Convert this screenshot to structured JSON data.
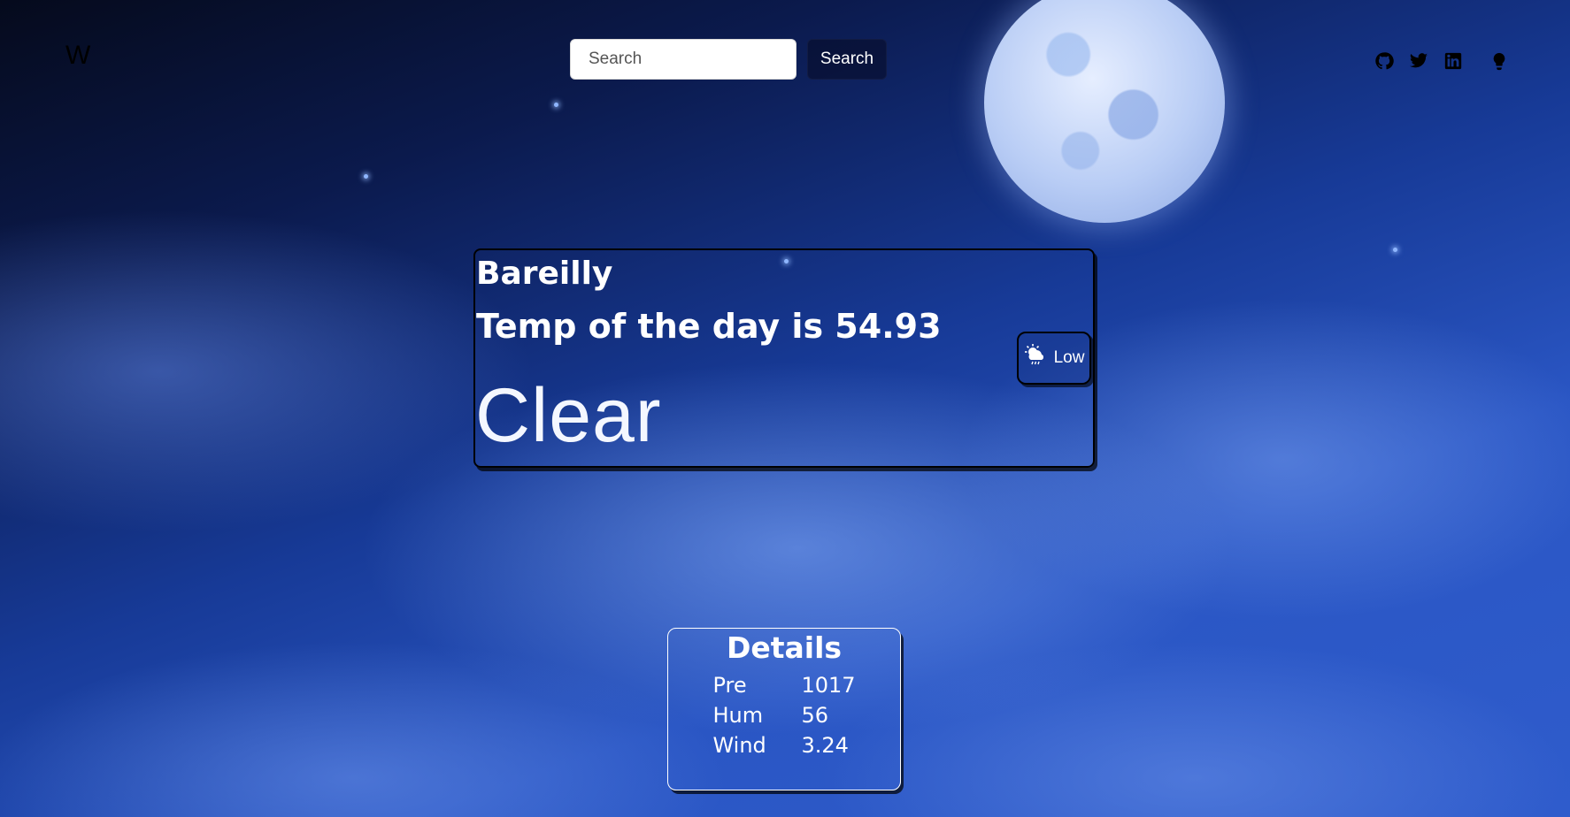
{
  "brand": "W",
  "search": {
    "placeholder": "Search",
    "value": "",
    "button_label": "Search"
  },
  "social_links": [
    {
      "icon": "github-icon"
    },
    {
      "icon": "twitter-icon"
    },
    {
      "icon": "linkedin-icon"
    },
    {
      "icon": "lightbulb-icon"
    }
  ],
  "weather": {
    "city": "Bareilly",
    "temp_text": "Temp of the day is 54.93",
    "condition": "Clear",
    "level_badge": {
      "icon": "cloud-rain-sun-icon",
      "label": "Low"
    }
  },
  "details": {
    "title": "Details",
    "rows": [
      {
        "label": "Pre",
        "value": "1017"
      },
      {
        "label": "Hum",
        "value": "56"
      },
      {
        "label": "Wind",
        "value": "3.24"
      }
    ]
  },
  "colors": {
    "text": "#ffffff",
    "sky_dark": "#050a1c",
    "sky_light": "#2f5ccc"
  }
}
